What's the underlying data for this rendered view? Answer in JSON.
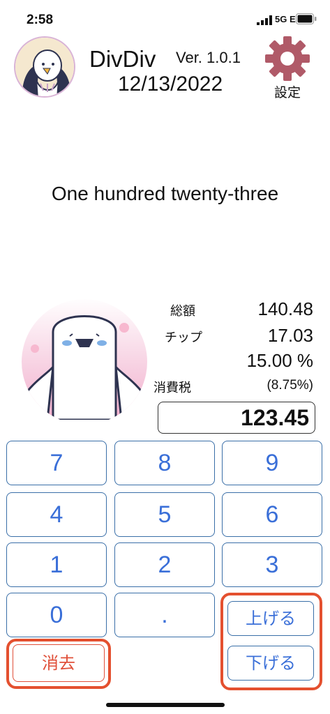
{
  "status_bar": {
    "time": "2:58",
    "network": "5G E"
  },
  "header": {
    "title": "DivDiv",
    "version": "Ver. 1.0.1",
    "date": "12/13/2022",
    "settings_label": "設定"
  },
  "amount_in_words": "One hundred twenty-three",
  "summary": {
    "total_label": "総額",
    "total_value": "140.48",
    "tip_label": "チップ",
    "tip_value": "17.03",
    "tip_percent": "15.00 %",
    "tax_label": "消費税",
    "tax_rate": "(8.75%)"
  },
  "amount_input": {
    "value": "123.45"
  },
  "keypad": {
    "keys": [
      "7",
      "8",
      "9",
      "4",
      "5",
      "6",
      "1",
      "2",
      "3",
      "0",
      "."
    ],
    "up_label": "上げる",
    "down_label": "下げる",
    "clear_label": "消去"
  },
  "colors": {
    "key_text": "#3a6fd8",
    "key_border": "#3a6fa8",
    "clear_text": "#e0503a",
    "highlight": "#e4502f",
    "gear": "#b05a68"
  }
}
